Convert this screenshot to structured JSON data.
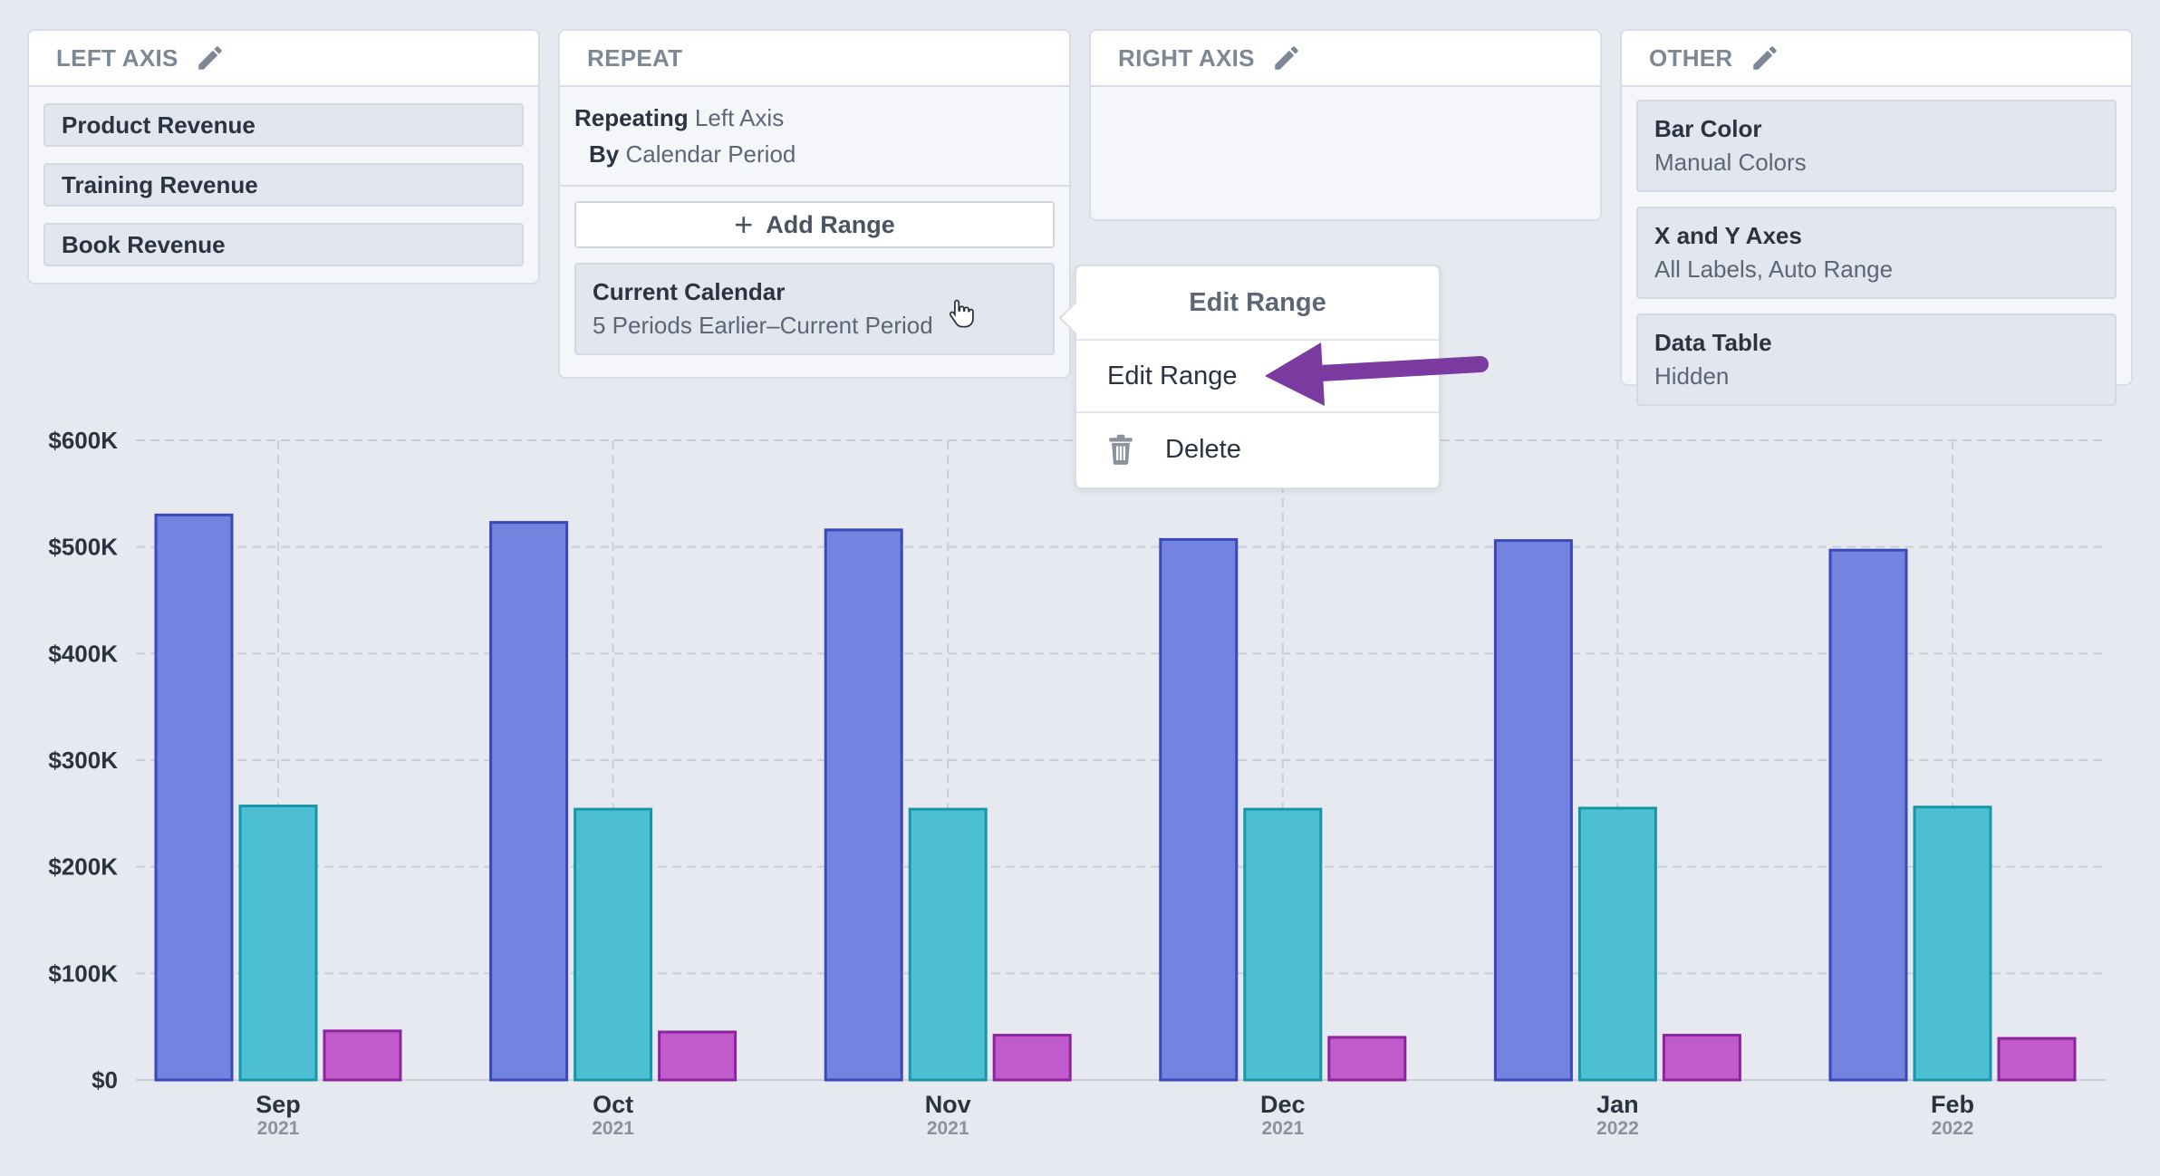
{
  "panels": {
    "left_axis": {
      "title": "LEFT AXIS",
      "items": [
        "Product Revenue",
        "Training Revenue",
        "Book Revenue"
      ]
    },
    "repeat": {
      "title": "REPEAT",
      "repeating_label": "Repeating",
      "repeating_value": "Left Axis",
      "by_label": "By",
      "by_value": "Calendar Period",
      "add_range_label": "Add Range",
      "range_title": "Current Calendar",
      "range_value": "5 Periods Earlier–Current Period"
    },
    "right_axis": {
      "title": "RIGHT AXIS"
    },
    "other": {
      "title": "OTHER",
      "items": [
        {
          "title": "Bar Color",
          "value": "Manual Colors"
        },
        {
          "title": "X and Y Axes",
          "value": "All Labels, Auto Range"
        },
        {
          "title": "Data Table",
          "value": "Hidden"
        }
      ]
    }
  },
  "context_menu": {
    "header": "Edit Range",
    "items": [
      {
        "label": "Edit Range",
        "icon": "none"
      },
      {
        "label": "Delete",
        "icon": "trash-icon"
      }
    ],
    "annotation_arrow_color": "#7b3aa0"
  },
  "chart_data": {
    "type": "bar",
    "categories": [
      "Sep",
      "Oct",
      "Nov",
      "Dec",
      "Jan",
      "Feb"
    ],
    "category_sublabels": [
      "2021",
      "2021",
      "2021",
      "2021",
      "2022",
      "2022"
    ],
    "series": [
      {
        "values": [
          530000,
          523000,
          516000,
          507000,
          506000,
          497000
        ],
        "color": "#7383e0",
        "stroke": "#3a48b8"
      },
      {
        "values": [
          257000,
          254000,
          254000,
          254000,
          255000,
          256000
        ],
        "color": "#4dbfd3",
        "stroke": "#1796a8"
      },
      {
        "values": [
          46000,
          45000,
          42000,
          40000,
          42000,
          39000
        ],
        "color": "#c15bcc",
        "stroke": "#8d23a0"
      }
    ],
    "ylim": [
      0,
      600000
    ],
    "yticks": [
      0,
      100000,
      200000,
      300000,
      400000,
      500000,
      600000
    ],
    "ytick_labels": [
      "$0",
      "$100K",
      "$200K",
      "$300K",
      "$400K",
      "$500K",
      "$600K"
    ],
    "grid": true,
    "xlabel": "",
    "ylabel": ""
  }
}
